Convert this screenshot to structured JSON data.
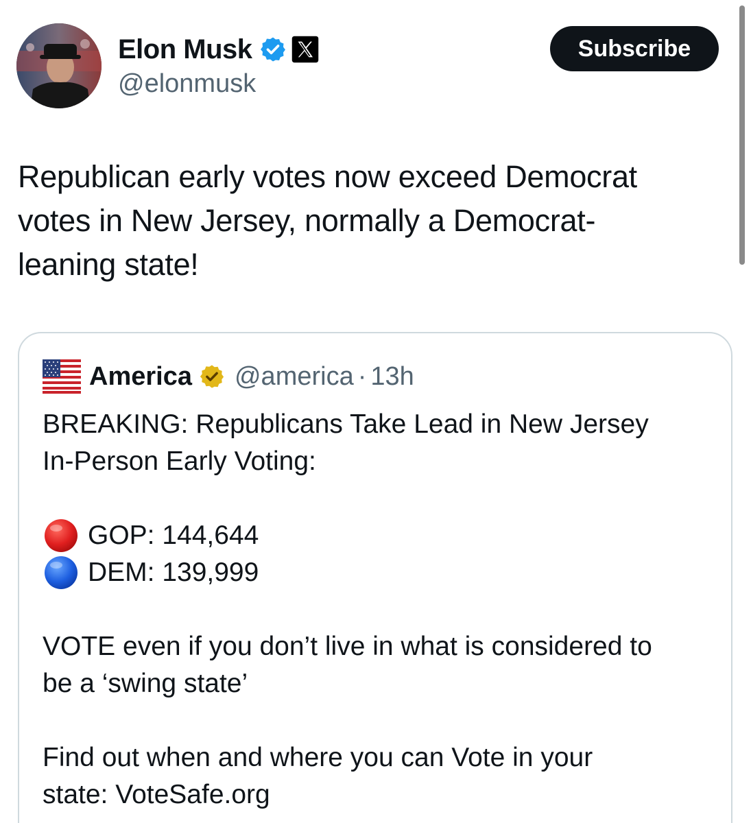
{
  "author": {
    "display_name": "Elon Musk",
    "handle": "@elonmusk",
    "badges": [
      "verified-blue-check-icon",
      "x-logo-icon"
    ]
  },
  "actions": {
    "subscribe_label": "Subscribe"
  },
  "tweet": {
    "text_lines": [
      "Republican early votes now exceed Democrat",
      "votes in New Jersey, normally a Democrat-",
      "leaning state!"
    ]
  },
  "quote": {
    "display_name": "America",
    "handle": "@america",
    "separator": "·",
    "time": "13h",
    "headline_lines": [
      "BREAKING: Republicans Take Lead in New Jersey",
      "In-Person Early Voting:"
    ],
    "votes": [
      {
        "icon": "red-circle-icon",
        "color": "#d91e1e",
        "label": "GOP: 144,644"
      },
      {
        "icon": "blue-circle-icon",
        "color": "#1e63d9",
        "label": "DEM: 139,999"
      }
    ],
    "vote_message_lines": [
      "VOTE even if you don’t live in what is considered to",
      "be a ‘swing state’"
    ],
    "find_out_lines": [
      "Find out when and where you can Vote in your",
      "state: VoteSafe.org"
    ]
  },
  "colors": {
    "text_primary": "#0f1419",
    "text_secondary": "#536471",
    "verified_blue": "#1d9bf0",
    "verified_gold": "#e2b719",
    "subscribe_bg": "#0f1419",
    "card_border": "#cfd9de"
  }
}
